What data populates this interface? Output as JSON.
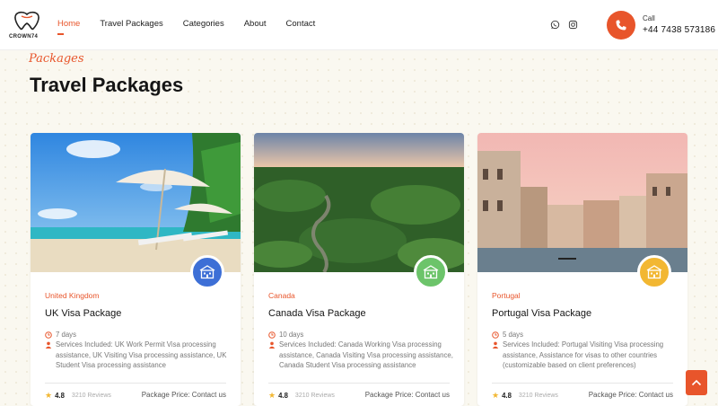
{
  "brand": {
    "logo_text": "CROWN74",
    "accent": "#e8552b"
  },
  "nav": {
    "items": [
      {
        "label": "Home",
        "active": true
      },
      {
        "label": "Travel Packages",
        "active": false
      },
      {
        "label": "Categories",
        "active": false
      },
      {
        "label": "About",
        "active": false
      },
      {
        "label": "Contact",
        "active": false
      }
    ]
  },
  "header": {
    "social": [
      "whatsapp-icon",
      "instagram-icon"
    ],
    "call_label": "Call",
    "call_number": "+44 7438 573186"
  },
  "section": {
    "eyebrow": "Packages",
    "title": "Travel Packages"
  },
  "cards": [
    {
      "country": "United Kingdom",
      "name": "UK Visa Package",
      "duration": "7 days",
      "services": "Services Included: UK Work Permit Visa processing assistance, UK Visiting Visa processing assistance, UK Student Visa processing assistance",
      "rating": "4.8",
      "reviews": "3210 Reviews",
      "price": "Package Price: Contact us",
      "badge_color": "#3d6fd6",
      "image": "beach-umbrella-image"
    },
    {
      "country": "Canada",
      "name": "Canada Visa Package",
      "duration": "10 days",
      "services": "Services Included: Canada Working Visa processing assistance, Canada Visiting Visa processing assistance, Canada Student Visa processing assistance",
      "rating": "4.8",
      "reviews": "3210 Reviews",
      "price": "Package Price: Contact us",
      "badge_color": "#6cc46a",
      "image": "forest-river-image"
    },
    {
      "country": "Portugal",
      "name": "Portugal Visa Package",
      "duration": "5 days",
      "services": "Services Included: Portugal Visiting Visa processing assistance, Assistance for visas to other countries (customizable based on client preferences)",
      "rating": "4.8",
      "reviews": "3210 Reviews",
      "price": "Package Price: Contact us",
      "badge_color": "#f2b732",
      "image": "venice-canal-image"
    }
  ]
}
